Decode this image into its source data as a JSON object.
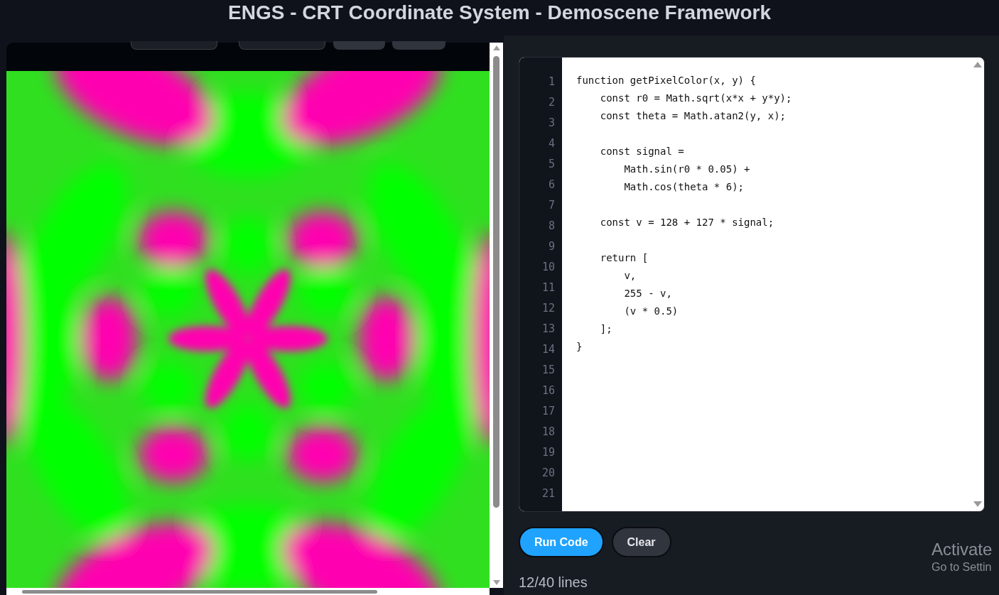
{
  "title": "ENGS - CRT Coordinate System - Demoscene Framework",
  "editor": {
    "line_numbers": [
      "1",
      "2",
      "3",
      "4",
      "5",
      "6",
      "7",
      "8",
      "9",
      "10",
      "11",
      "12",
      "13",
      "14",
      "15",
      "16",
      "17",
      "18",
      "19",
      "20",
      "21"
    ],
    "code": "function getPixelColor(x, y) {\n    const r0 = Math.sqrt(x*x + y*y);\n    const theta = Math.atan2(y, x);\n\n    const signal =\n        Math.sin(r0 * 0.05) +\n        Math.cos(theta * 6);\n\n    const v = 128 + 127 * signal;\n\n    return [\n        v,\n        255 - v,\n        (v * 0.5)\n    ];\n}"
  },
  "buttons": [
    {
      "label": "Run Code",
      "kind": "primary"
    },
    {
      "label": "Clear",
      "kind": "secondary"
    }
  ],
  "status": "12/40 lines",
  "os_notice": {
    "title": "Activate",
    "subtitle": "Go to Settin"
  }
}
